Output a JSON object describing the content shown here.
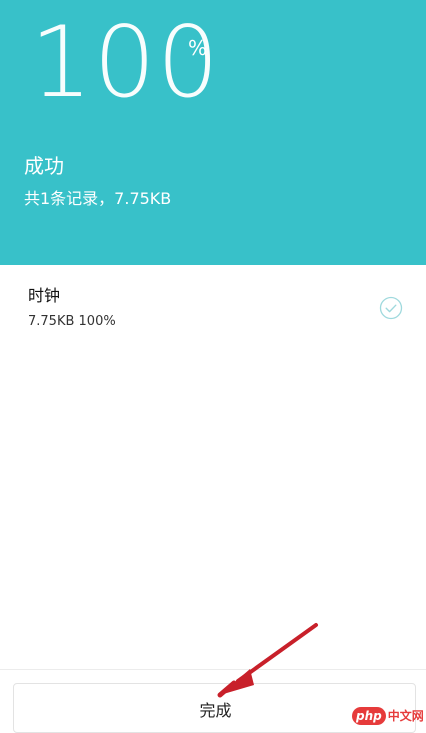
{
  "header": {
    "progress_value": "100",
    "progress_unit": "%",
    "status_title": "成功",
    "summary": "共1条记录，7.75KB",
    "background_color": "#38c1c9"
  },
  "items": [
    {
      "name": "时钟",
      "detail": "7.75KB 100%",
      "status_icon": "check-circle-icon"
    }
  ],
  "footer": {
    "done_label": "完成"
  },
  "annotation": {
    "arrow_color": "#c8202a",
    "arrow_icon": "red-arrow-pointer"
  },
  "watermark": {
    "brand": "php",
    "text": "中文网"
  }
}
